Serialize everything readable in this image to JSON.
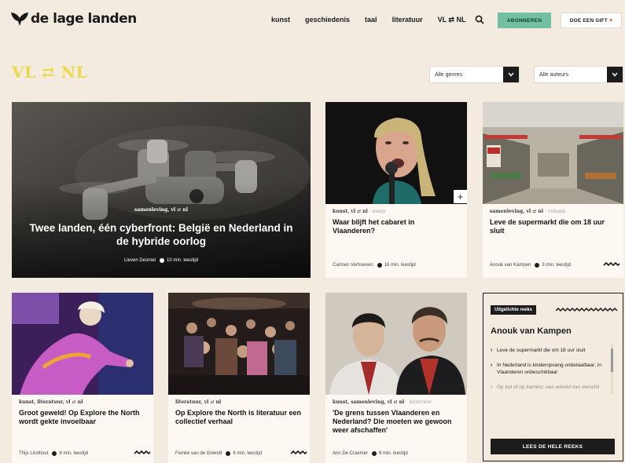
{
  "brand": {
    "name": "de lage landen"
  },
  "nav": {
    "items": [
      "kunst",
      "geschiedenis",
      "taal",
      "literatuur",
      "VL ⇄ NL"
    ]
  },
  "header": {
    "subscribe_label": "ABONNEREN",
    "gift_label": "DOE EEN GIFT",
    "gift_heart": "♥"
  },
  "page": {
    "title": "VL ⇄ NL"
  },
  "filters": {
    "genres": "Alle genres",
    "authors": "Alle auteurs"
  },
  "featured": {
    "tags": "samenleving, vl ⇄ nl",
    "title": "Twee landen, één cyberfront: België en Nederland in de hybride oorlog",
    "author": "Lieven Desmet",
    "read_time": "10 min. leestijd"
  },
  "cards": [
    {
      "tags": "kunst, vl ⇄ nl",
      "type": "essay",
      "title": "Waar blijft het cabaret in Vlaanderen?",
      "author": "Carmen Verhoeven",
      "read_time": "16 min. leestijd",
      "plus": "+"
    },
    {
      "tags": "samenleving, vl ⇄ nl",
      "type": "column",
      "title": "Leve de supermarkt die om 18 uur sluit",
      "author": "Anouk van Kampen",
      "read_time": "3 min. leestijd"
    },
    {
      "tags": "kunst, literatuur, vl ⇄ nl",
      "type": "",
      "title": "Groot geweld! Op Explore the North wordt gekte invoelbaar",
      "author": "Thijs Lindhout",
      "read_time": "9 min. leestijd"
    },
    {
      "tags": "literatuur, vl ⇄ nl",
      "type": "",
      "title": "Op Explore the North is literatuur een collectief verhaal",
      "author": "Femke van de Griendt",
      "read_time": "6 min. leestijd"
    },
    {
      "tags": "kunst, samenleving, vl ⇄ nl",
      "type": "interview",
      "title": "'De grens tussen Vlaanderen en Nederland? Die moeten we gewoon weer afschaffen'",
      "author": "Ann De Craemer",
      "read_time": "6 min. leestijd"
    }
  ],
  "series": {
    "badge": "Uitgelichte reeks",
    "name": "Anouk van Kampen",
    "items": [
      {
        "text": "Leve de supermarkt die om 18 uur sluit"
      },
      {
        "a": "In Nederland is kinderopvang ",
        "b": "onbetaalbaar",
        "c": ", in Vlaanderen ",
        "d": "onbeschikbaar"
      },
      {
        "a": "Op ",
        "b": "kot",
        "c": " of op ",
        "d": "kamers",
        "e": ": een wereld van verschil"
      }
    ],
    "button": "LEES DE HELE REEKS"
  }
}
